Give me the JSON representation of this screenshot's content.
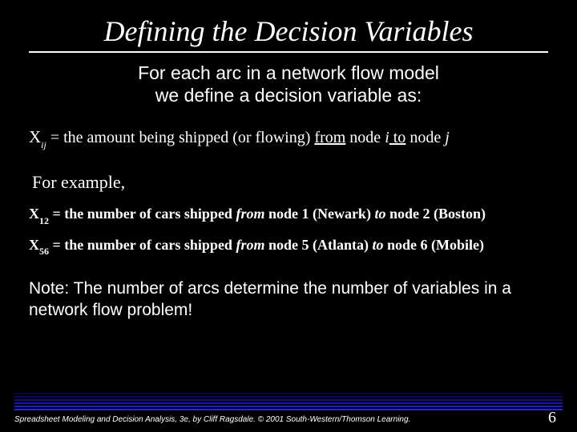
{
  "title": "Defining the Decision Variables",
  "intro_line1": "For each arc in a network flow model",
  "intro_line2": "we define a decision variable as:",
  "defn": {
    "var": "X",
    "sub": "ij",
    "eq": " = the amount being shipped (or flowing) ",
    "from_word": "from",
    "mid": " node ",
    "i": "i",
    "to_word": " to",
    "end": " node ",
    "j": "j"
  },
  "for_example_label": "For example,",
  "examples": [
    {
      "var": "X",
      "sub": "12",
      "eq": " = the number of cars shipped ",
      "from": "from",
      "mid1": " node 1 (Newark) ",
      "to": "to",
      "mid2": " node 2 (Boston)"
    },
    {
      "var": "X",
      "sub": "56",
      "eq": " = the number of cars shipped ",
      "from": "from",
      "mid1": " node 5 (Atlanta) ",
      "to": "to",
      "mid2": " node 6 (Mobile)"
    }
  ],
  "note": "Note: The number of arcs determine the number of variables in a network flow problem!",
  "credit": "Spreadsheet Modeling and Decision Analysis, 3e, by Cliff Ragsdale. © 2001 South-Western/Thomson Learning.",
  "page": "6"
}
